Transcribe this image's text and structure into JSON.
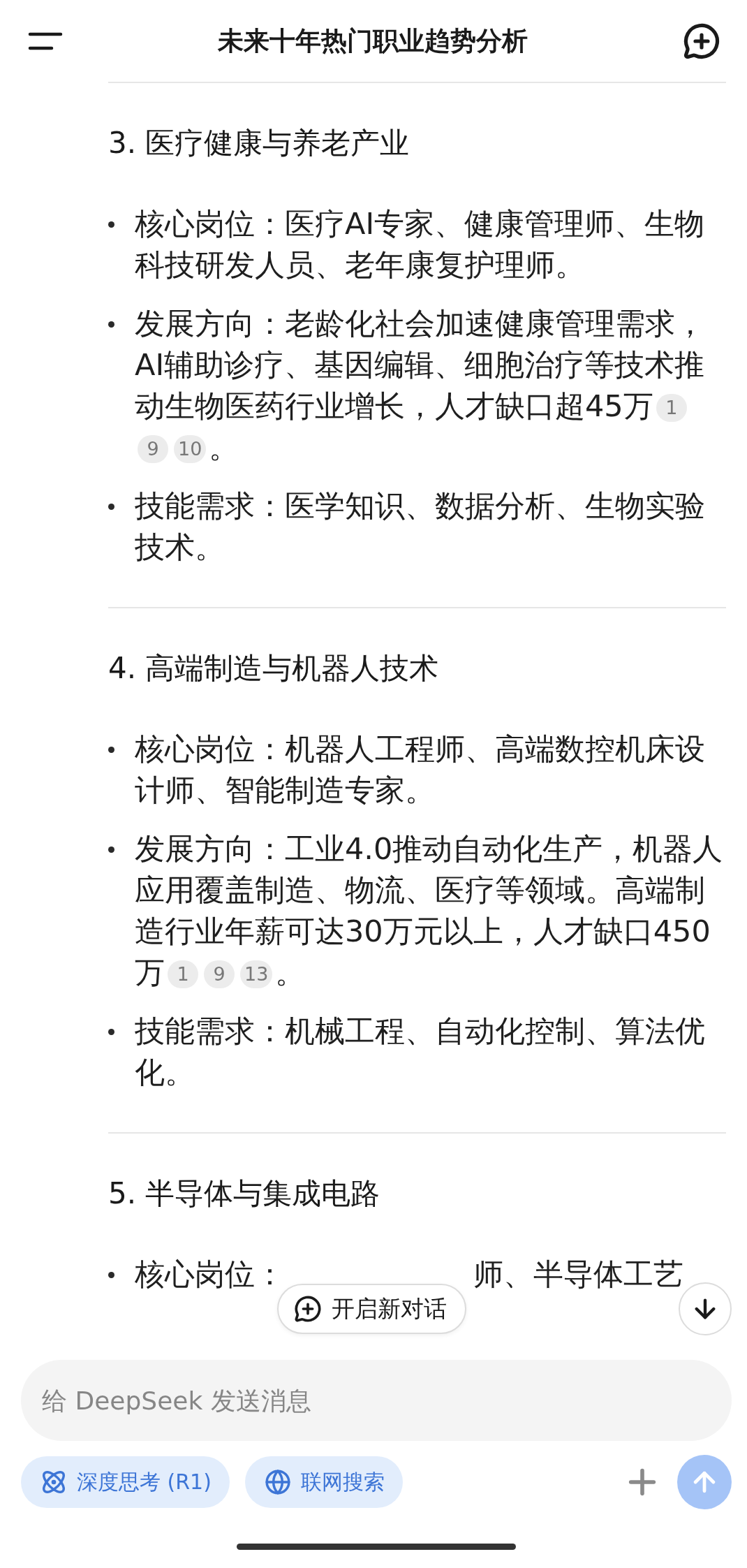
{
  "header": {
    "title": "未来十年热门职业趋势分析"
  },
  "sections": [
    {
      "heading": "3. 医疗健康与养老产业",
      "items": [
        {
          "kind": "text",
          "text": "核心岗位：医疗AI专家、健康管理师、生物科技研发人员、老年康复护理师。"
        },
        {
          "kind": "text",
          "text": "发展方向：老龄化社会加速健康管理需求，AI辅助诊疗、基因编辑、细胞治疗等技术推动生物医药行业增长，人才缺口超45万",
          "citations": [
            "1",
            "9",
            "10"
          ],
          "end": "。"
        },
        {
          "kind": "text",
          "text": "技能需求：医学知识、数据分析、生物实验技术。"
        }
      ]
    },
    {
      "heading": "4. 高端制造与机器人技术",
      "items": [
        {
          "kind": "text",
          "text": "核心岗位：机器人工程师、高端数控机床设计师、智能制造专家。"
        },
        {
          "kind": "text",
          "text": "发展方向：工业4.0推动自动化生产，机器人应用覆盖制造、物流、医疗等领域。高端制造行业年薪可达30万元以上，人才缺口450万",
          "citations": [
            "1",
            "9",
            "13"
          ],
          "end": "。"
        },
        {
          "kind": "text",
          "text": "技能需求：机械工程、自动化控制、算法优化。"
        }
      ]
    },
    {
      "heading": "5. 半导体与集成电路",
      "items": [
        {
          "kind": "obscured",
          "parts": [
            "核心岗位：",
            "师、半导体工艺"
          ]
        }
      ]
    }
  ],
  "new_chat_button": {
    "label": "开启新对话"
  },
  "composer": {
    "placeholder": "给 DeepSeek 发送消息",
    "toggles": [
      {
        "kind": "think",
        "label": "深度思考 (R1)",
        "selected": false
      },
      {
        "kind": "search",
        "label": "联网搜索",
        "selected": false
      }
    ],
    "send_enabled": false
  }
}
